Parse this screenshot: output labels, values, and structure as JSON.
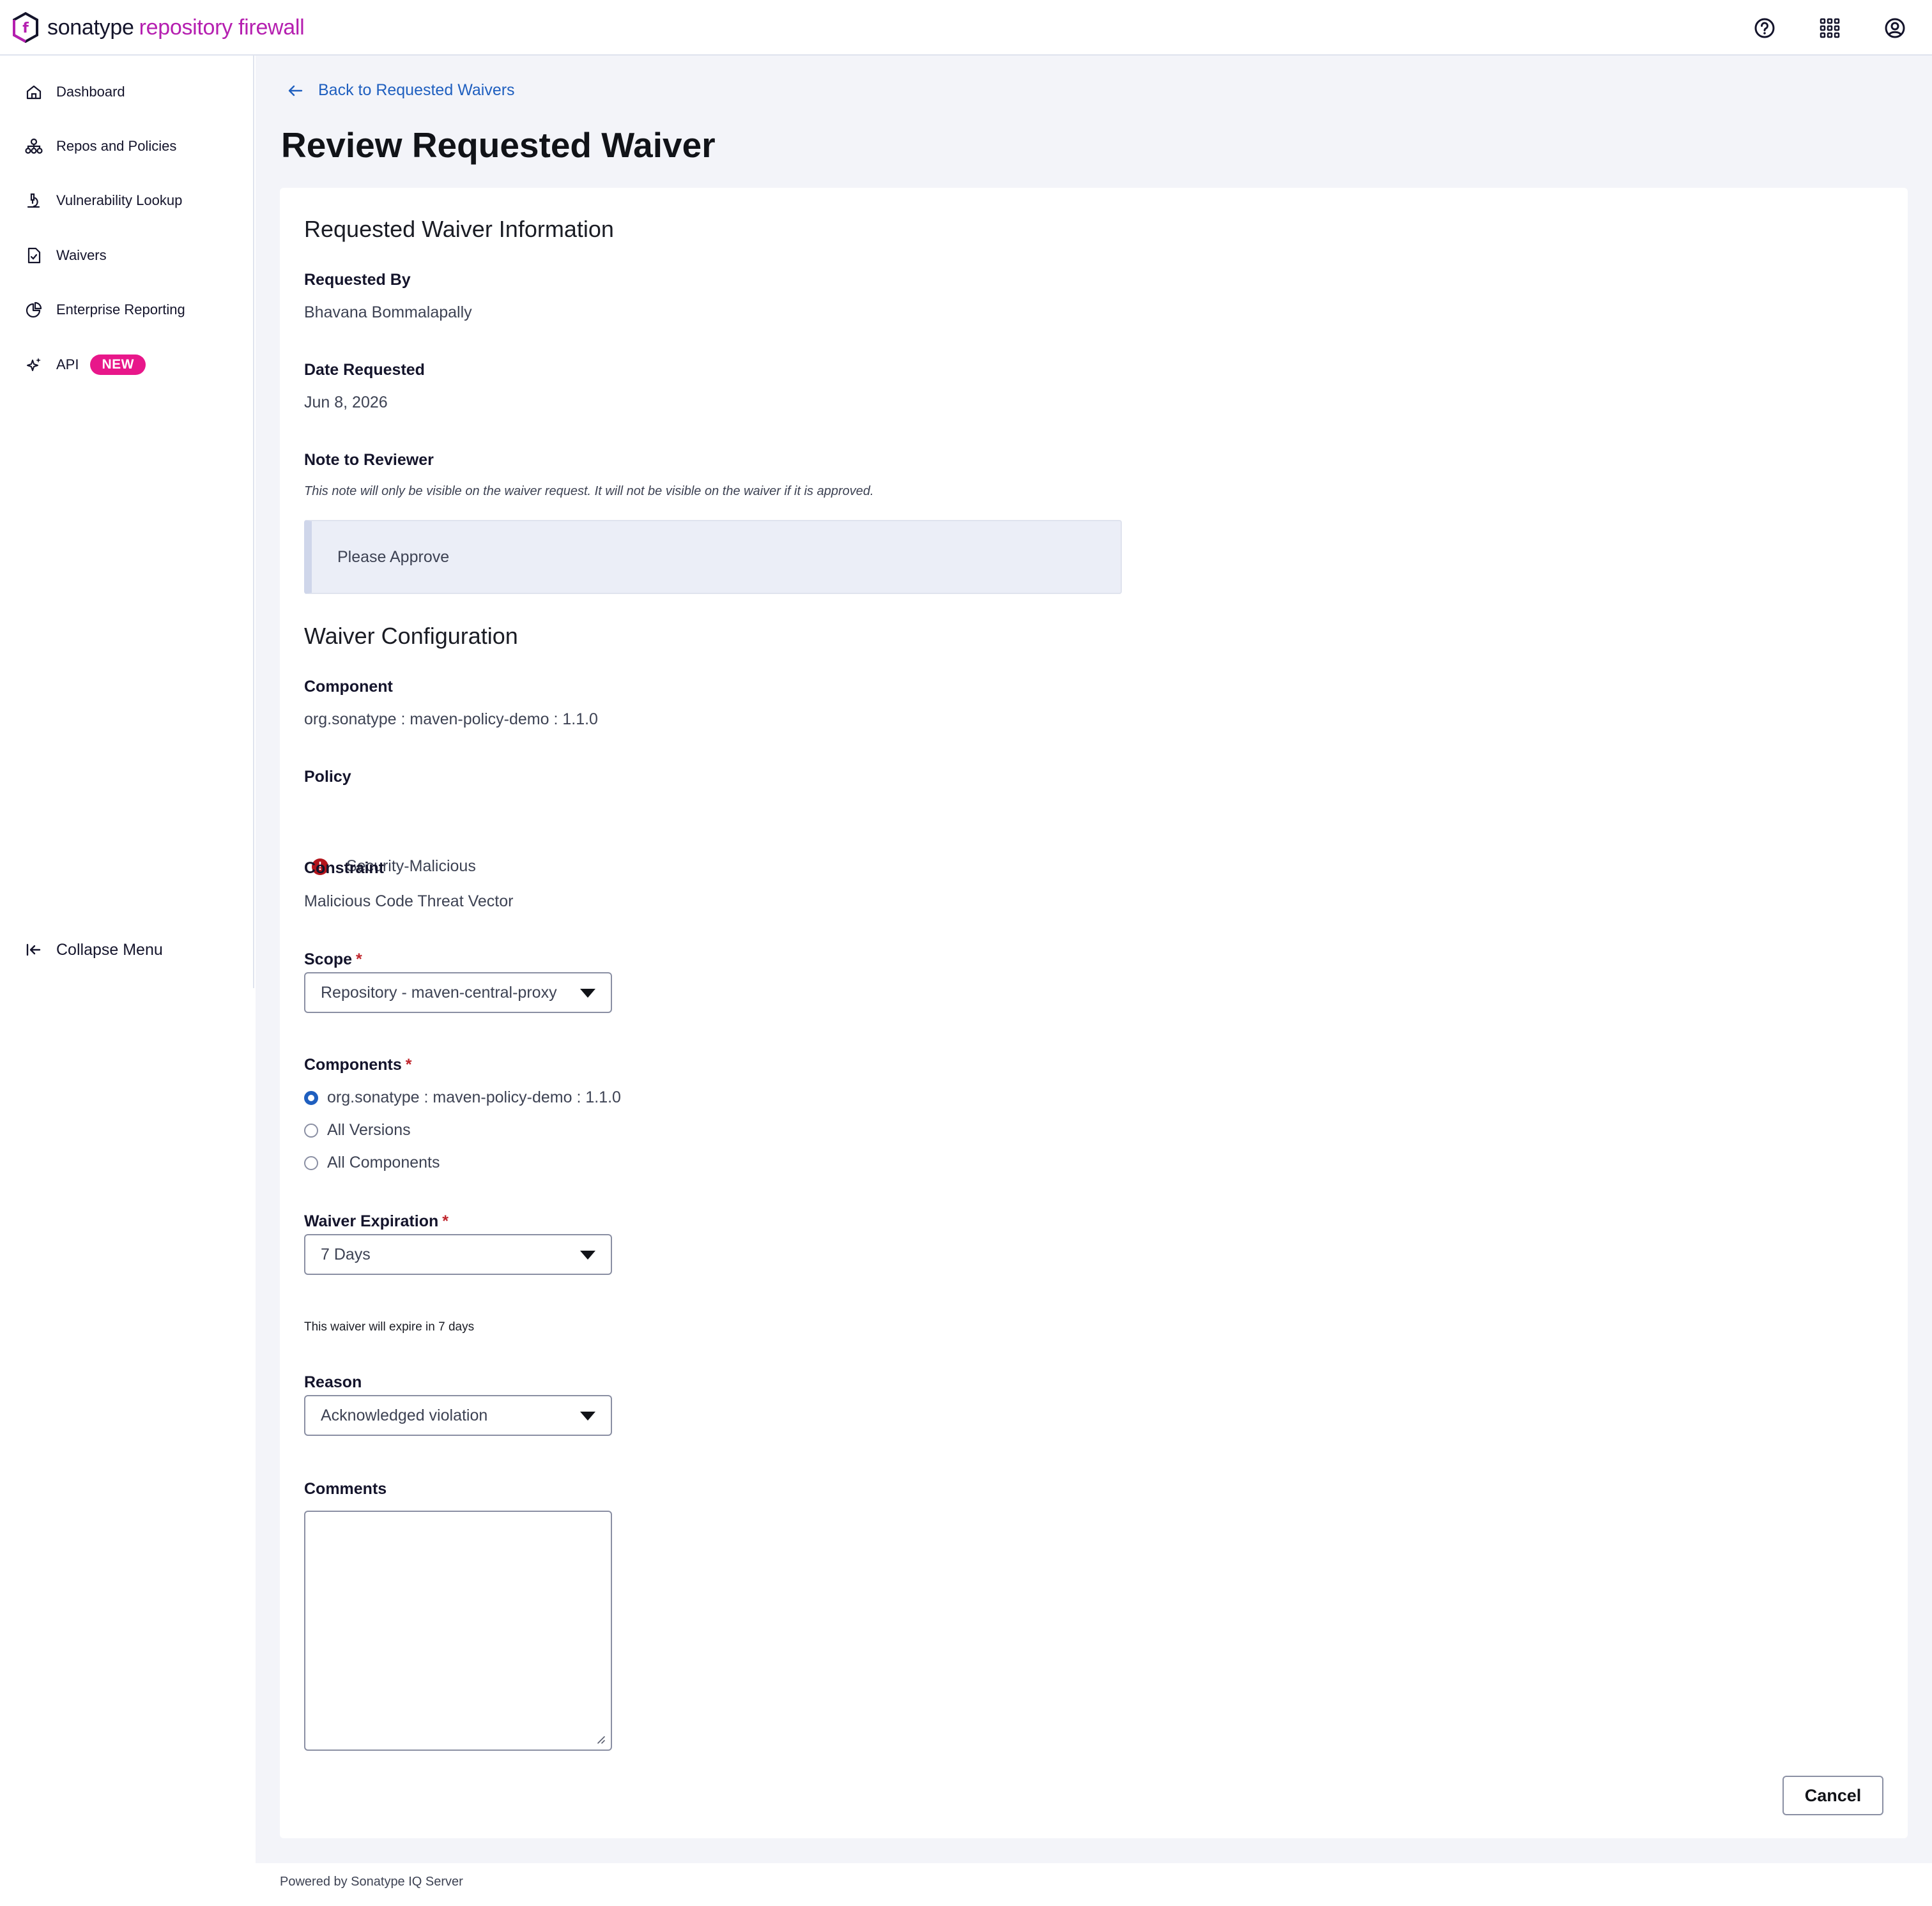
{
  "header": {
    "brand_primary": "sonatype",
    "brand_secondary": "repository firewall",
    "brand_color": "#b51fb0",
    "icons": [
      "help-icon",
      "apps-grid-icon",
      "user-account-icon"
    ]
  },
  "sidebar": {
    "items": [
      {
        "label": "Dashboard",
        "icon": "home-icon"
      },
      {
        "label": "Repos and Policies",
        "icon": "hierarchy-icon"
      },
      {
        "label": "Vulnerability Lookup",
        "icon": "microscope-icon"
      },
      {
        "label": "Waivers",
        "icon": "document-check-icon"
      },
      {
        "label": "Enterprise Reporting",
        "icon": "pie-chart-icon"
      },
      {
        "label": "API",
        "icon": "sparkle-icon",
        "badge": "NEW"
      }
    ],
    "badge_color": "#e8178a",
    "collapse_label": "Collapse Menu"
  },
  "main": {
    "back_link": "Back to Requested Waivers",
    "title": "Review Requested Waiver",
    "info": {
      "section_title": "Requested Waiver Information",
      "requested_by_label": "Requested By",
      "requested_by": "Bhavana Bommalapally",
      "date_label": "Date Requested",
      "date": "Jun 8, 2026",
      "note_label": "Note to Reviewer",
      "note_helper": "This note will only be visible on the waiver request. It will not be visible on the waiver if it is approved.",
      "note": "Please Approve"
    },
    "config": {
      "section_title": "Waiver Configuration",
      "component_label": "Component",
      "component": "org.sonatype : maven-policy-demo : 1.1.0",
      "policy_label": "Policy",
      "policy": "Security-Malicious",
      "policy_color": "#b3141b",
      "constraint_label": "Constraint",
      "constraint": "Malicious Code Threat Vector",
      "scope_label": "Scope",
      "scope_value": "Repository - maven-central-proxy",
      "components_label": "Components",
      "components_options": [
        {
          "label": "org.sonatype : maven-policy-demo : 1.1.0",
          "selected": true
        },
        {
          "label": "All Versions",
          "selected": false
        },
        {
          "label": "All Components",
          "selected": false
        }
      ],
      "expiration_label": "Waiver Expiration",
      "expiration_value": "7 Days",
      "expiration_note": "This waiver will expire in 7 days",
      "reason_label": "Reason",
      "reason_value": "Acknowledged violation",
      "comments_label": "Comments",
      "comments_value": ""
    },
    "cancel_label": "Cancel",
    "required_marker": "*"
  },
  "footer": {
    "text": "Powered by Sonatype IQ Server"
  }
}
